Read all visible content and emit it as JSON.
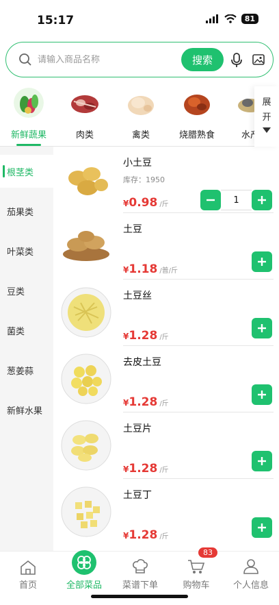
{
  "status": {
    "time": "15:17",
    "battery": "81"
  },
  "search": {
    "placeholder": "请输入商品名称",
    "button_label": "搜索"
  },
  "categories": {
    "items": [
      {
        "label": "新鲜蔬果",
        "active": true
      },
      {
        "label": "肉类"
      },
      {
        "label": "禽类"
      },
      {
        "label": "烧腊熟食"
      },
      {
        "label": "水产"
      }
    ],
    "expand_label_1": "展",
    "expand_label_2": "开"
  },
  "sidebar": {
    "items": [
      {
        "label": "根茎类",
        "active": true
      },
      {
        "label": "茄果类"
      },
      {
        "label": "叶菜类"
      },
      {
        "label": "豆类"
      },
      {
        "label": "菌类"
      },
      {
        "label": "葱姜蒜"
      },
      {
        "label": "新鲜水果"
      }
    ]
  },
  "products": [
    {
      "name": "小土豆",
      "stock": "库存：1950",
      "currency": "¥",
      "price": "0.98",
      "unit": "/斤",
      "quantity": "1"
    },
    {
      "name": "土豆",
      "currency": "¥",
      "price": "1.18",
      "unit": "/普/斤"
    },
    {
      "name": "土豆丝",
      "currency": "¥",
      "price": "1.28",
      "unit": "/斤"
    },
    {
      "name": "去皮土豆",
      "currency": "¥",
      "price": "1.28",
      "unit": "/斤"
    },
    {
      "name": "土豆片",
      "currency": "¥",
      "price": "1.28",
      "unit": "/斤"
    },
    {
      "name": "土豆丁",
      "currency": "¥",
      "price": "1.28",
      "unit": "/斤"
    }
  ],
  "tabbar": {
    "items": [
      {
        "label": "首页"
      },
      {
        "label": "全部菜品",
        "active": true
      },
      {
        "label": "菜谱下单"
      },
      {
        "label": "购物车",
        "badge": "83"
      },
      {
        "label": "个人信息"
      }
    ]
  },
  "colors": {
    "accent": "#1fc16f",
    "price": "#e53935"
  }
}
